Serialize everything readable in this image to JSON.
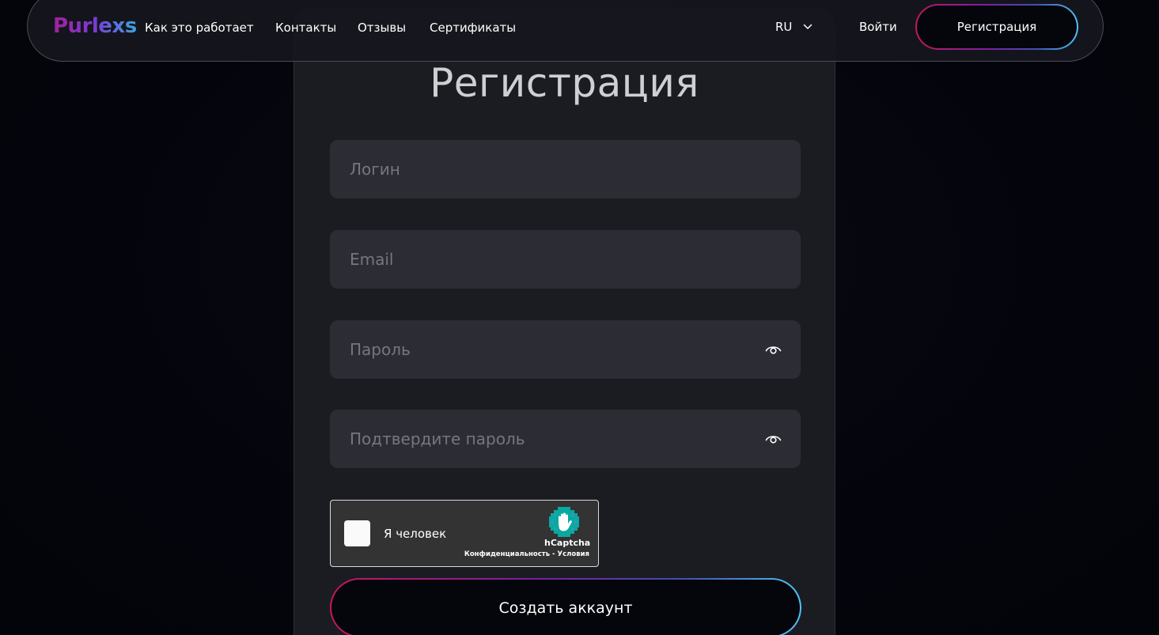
{
  "header": {
    "logo": "Purlexs",
    "nav": [
      {
        "label": "Как это работает"
      },
      {
        "label": "Контакты"
      },
      {
        "label": "Отзывы"
      },
      {
        "label": "Сертификаты"
      }
    ],
    "language": "RU",
    "login_label": "Войти",
    "register_label": "Регистрация"
  },
  "form": {
    "title": "Регистрация",
    "login_placeholder": "Логин",
    "email_placeholder": "Email",
    "password_placeholder": "Пароль",
    "confirm_placeholder": "Подтвердите пароль",
    "captcha": {
      "label": "Я человек",
      "brand": "hCaptcha",
      "privacy": "Конфиденциальность",
      "separator": " - ",
      "terms": "Условия"
    },
    "submit_label": "Создать аккаунт"
  },
  "colors": {
    "background": "#03030d",
    "card": "#1b1c21",
    "field": "#2c2c35",
    "gradient_start": "#c2185b",
    "gradient_mid": "#7b1fa2",
    "gradient_end": "#4fc3f7",
    "captcha_teal": "#0aa89e"
  },
  "icons": {
    "password_toggle": "eye-icon",
    "language_toggle": "chevron-down-icon",
    "captcha_logo": "hcaptcha-hand-icon"
  }
}
